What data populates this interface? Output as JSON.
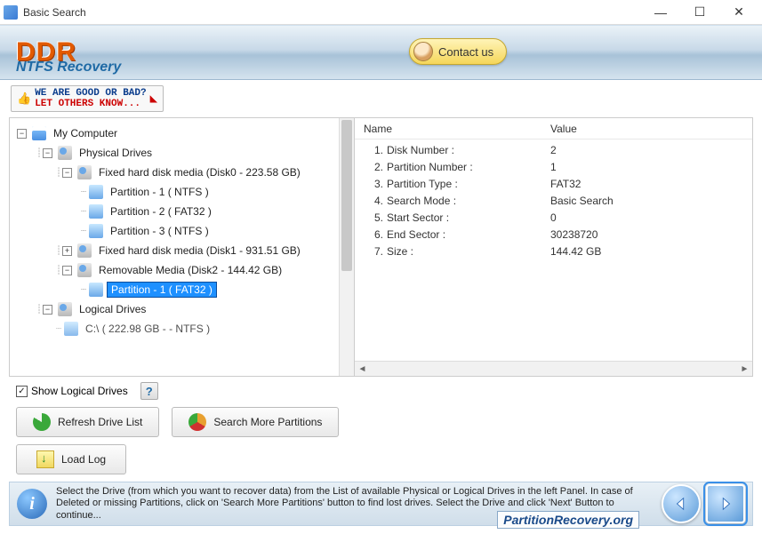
{
  "window": {
    "title": "Basic Search"
  },
  "banner": {
    "brand": "DDR",
    "product": "NTFS Recovery",
    "contact_label": "Contact us"
  },
  "feedback": {
    "line1": "WE ARE GOOD OR BAD?",
    "line2": "LET OTHERS KNOW..."
  },
  "tree": {
    "root": "My Computer",
    "physical_label": "Physical Drives",
    "disk0": "Fixed hard disk media (Disk0 - 223.58 GB)",
    "disk0_parts": [
      "Partition - 1 ( NTFS )",
      "Partition - 2 ( FAT32 )",
      "Partition - 3 ( NTFS )"
    ],
    "disk1": "Fixed hard disk media (Disk1 - 931.51 GB)",
    "disk2": "Removable Media (Disk2 - 144.42 GB)",
    "disk2_part": "Partition - 1 ( FAT32 )",
    "logical_label": "Logical Drives",
    "logical_first": "C:\\ ( 222.98 GB - - NTFS )"
  },
  "details": {
    "header_name": "Name",
    "header_value": "Value",
    "rows": [
      {
        "k": "Disk Number :",
        "v": "2"
      },
      {
        "k": "Partition Number :",
        "v": "1"
      },
      {
        "k": "Partition Type :",
        "v": "FAT32"
      },
      {
        "k": "Search Mode :",
        "v": "Basic Search"
      },
      {
        "k": "Start Sector :",
        "v": "0"
      },
      {
        "k": "End Sector :",
        "v": "30238720"
      },
      {
        "k": "Size :",
        "v": "144.42 GB"
      }
    ]
  },
  "options": {
    "show_logical": "Show Logical Drives",
    "help": "?"
  },
  "buttons": {
    "refresh": "Refresh Drive List",
    "search_more": "Search More Partitions",
    "load_log": "Load Log"
  },
  "info": {
    "text": "Select the Drive (from which you want to recover data) from the List of available Physical or Logical Drives in the left Panel. In case of Deleted or missing Partitions, click on 'Search More Partitions' button to find lost drives. Select the Drive and click 'Next' Button to continue..."
  },
  "watermark": "PartitionRecovery.org"
}
